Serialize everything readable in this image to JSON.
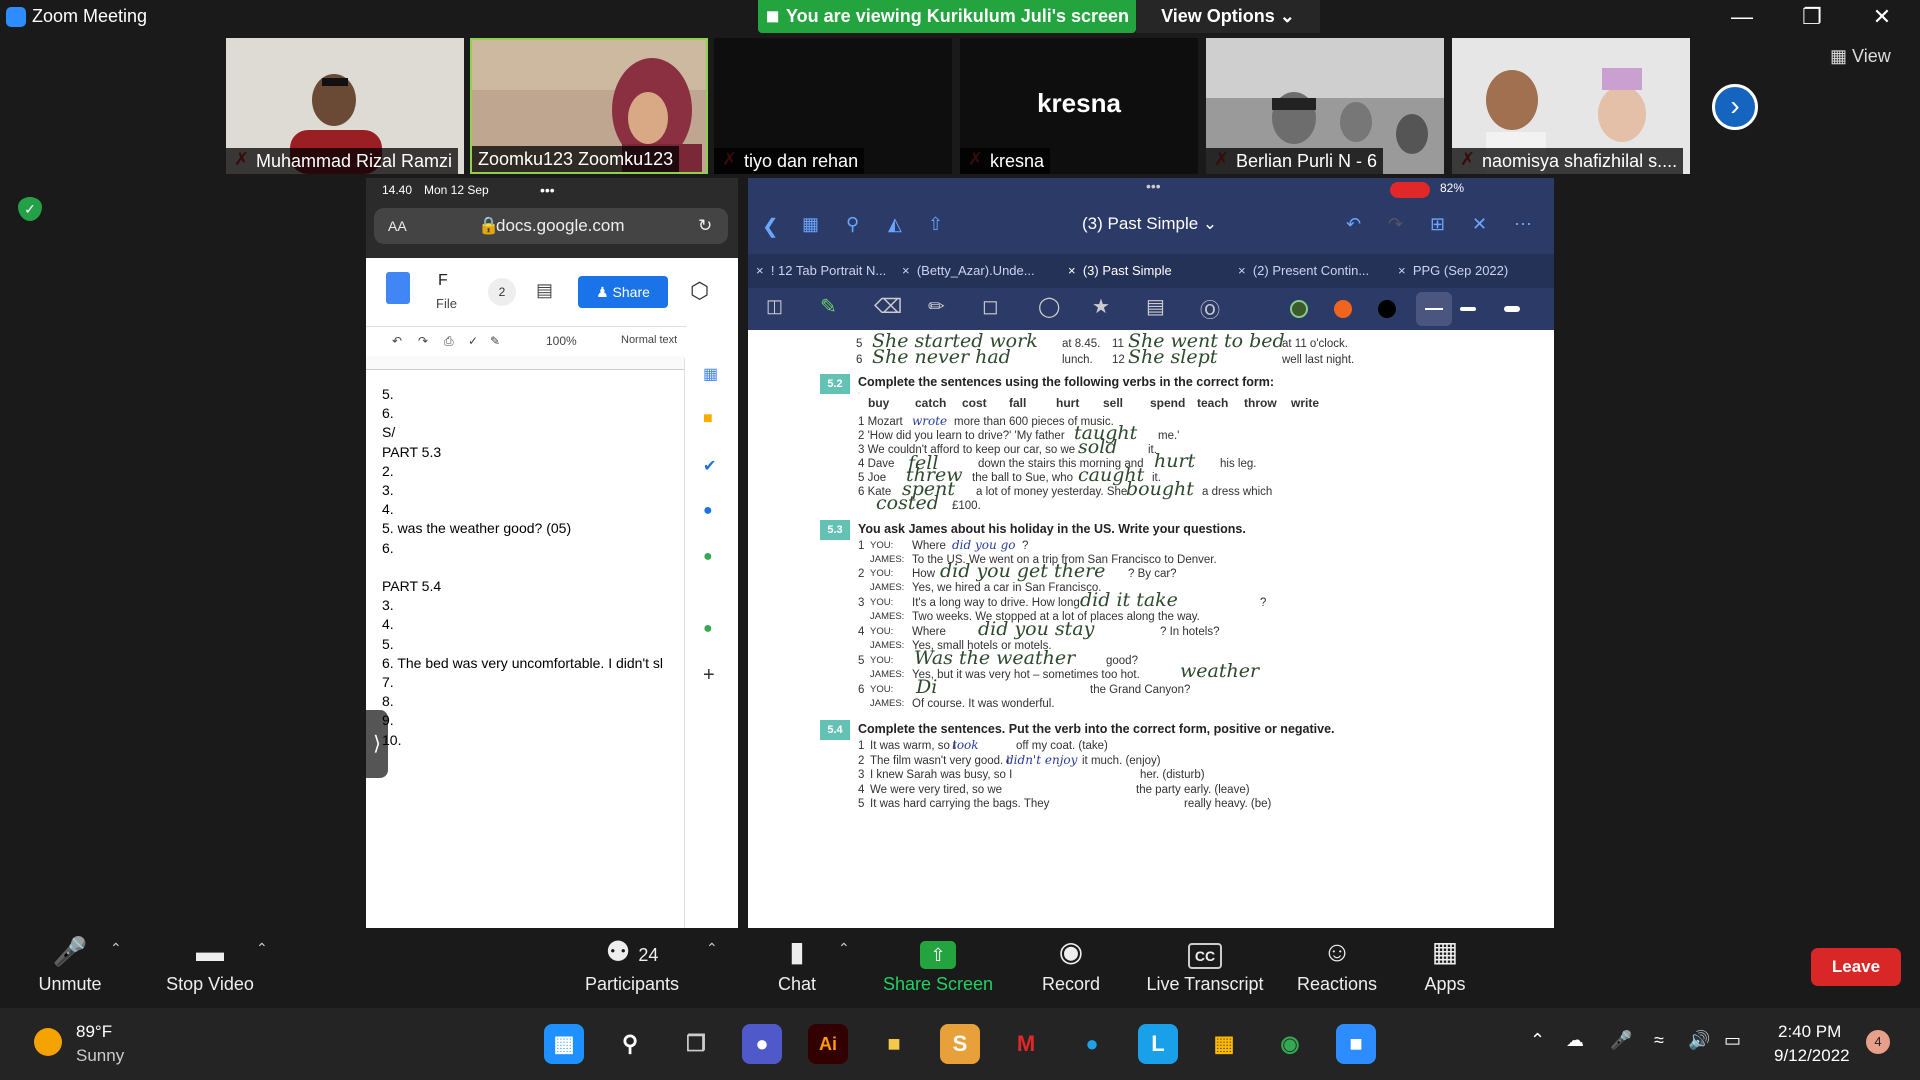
{
  "window": {
    "title": "Zoom Meeting",
    "viewing_banner": "You are viewing Kurikulum Juli's screen",
    "view_options": "View Options"
  },
  "gallery": {
    "participants": [
      {
        "name": "Muhammad Rizal Ramzi",
        "muted": true
      },
      {
        "name": "Zoomku123 Zoomku123",
        "muted": false
      },
      {
        "name": "tiyo dan rehan",
        "muted": true
      },
      {
        "name": "kresna",
        "muted": true,
        "display": "kresna"
      },
      {
        "name": "Berlian Purli N - 6",
        "muted": true
      },
      {
        "name": "naomisya shafizhilal s....",
        "muted": true
      }
    ],
    "view_label": "View"
  },
  "left_phone": {
    "time": "14.40",
    "date": "Mon 12 Sep",
    "url_aa": "AA",
    "url": "docs.google.com",
    "doc_title_initial": "F",
    "doc_menu": "File",
    "comment_count": "2",
    "share_label": "Share",
    "zoom_level": "100%",
    "style_label": "Normal text",
    "lines": [
      "5.",
      "6.",
      "S/",
      "PART 5.3",
      "2.",
      "3.",
      "4.",
      "5. was the weather good? (05)",
      "6.",
      "",
      "PART 5.4",
      "3.",
      "4.",
      "5.",
      "6. The bed was very uncomfortable. I didn't sl",
      "7.",
      "8.",
      "9.",
      "10."
    ]
  },
  "ipad": {
    "battery": "82%",
    "doc_title": "(3) Past Simple",
    "tabs": [
      "! 12 Tab Portrait N...",
      "(Betty_Azar).Unde...",
      "(3) Past Simple",
      "(2) Present Contin...",
      "PPG (Sep 2022)"
    ],
    "page": {
      "top_rows": [
        {
          "num": "5",
          "hw": "She started work",
          "tail": "at 8.45."
        },
        {
          "num": "6",
          "hw": "She never had",
          "tail": "lunch."
        },
        {
          "num": "11",
          "hw": "She went to bed",
          "tail": "at 11 o'clock."
        },
        {
          "num": "12",
          "hw": "She slept",
          "tail": "well last night."
        }
      ],
      "ex52": {
        "num": "5.2",
        "title": "Complete the sentences using the following verbs in the correct form:",
        "verbs": [
          "buy",
          "catch",
          "cost",
          "fall",
          "hurt",
          "sell",
          "spend",
          "teach",
          "throw",
          "write"
        ],
        "lines": [
          "1  Mozart",
          "more than 600 pieces of music.",
          "2  'How did you learn to drive?'   'My father",
          "me.'",
          "3  We couldn't afford to keep our car, so we",
          "it.",
          "4  Dave",
          "down the stairs this morning and",
          "his leg.",
          "5  Joe",
          "the ball to Sue, who",
          "it.",
          "6  Kate",
          "a lot of money yesterday.  She",
          "a dress which",
          "£100."
        ],
        "answers": [
          "wrote",
          "taught",
          "sold",
          "fell",
          "hurt",
          "threw",
          "caught",
          "spent",
          "bought",
          "costed"
        ]
      },
      "ex53": {
        "num": "5.3",
        "title": "You ask James about his holiday in the US.  Write your questions.",
        "you": "YOU:",
        "james": "JAMES:",
        "q1": "Where",
        "q1a": "did you go",
        "q1end": "?",
        "a1": "To the US. We went on a trip from San Francisco to Denver.",
        "q2": "How",
        "q2a": "did you get there",
        "q2end": "? By car?",
        "a2": "Yes, we hired a car in San Francisco.",
        "q3": "It's a long way to drive.  How long",
        "q3a": "did it take",
        "q3end": "?",
        "a3": "Two weeks. We stopped at a lot of places along the way.",
        "q4": "Where",
        "q4a": "did you stay",
        "q4end": "? In hotels?",
        "a4": "Yes, small hotels or motels.",
        "q5a": "Was the weather",
        "q5end": "good?",
        "a5": "Yes, but it was very hot – sometimes too hot.",
        "a5note": "weather",
        "q6a": "Di",
        "q6end": "the Grand Canyon?",
        "a6": "Of course.  It was wonderful.",
        "nums": [
          "1",
          "2",
          "3",
          "4",
          "5",
          "6"
        ]
      },
      "ex54": {
        "num": "5.4",
        "title": "Complete the sentences. Put the verb into the correct form, positive or negative.",
        "lines": [
          {
            "n": "1",
            "pre": "It was warm, so I",
            "ans": "took",
            "post": "off my coat. (take)"
          },
          {
            "n": "2",
            "pre": "The film wasn't very good.  I",
            "ans": "didn't enjoy",
            "post": "it much.  (enjoy)"
          },
          {
            "n": "3",
            "pre": "I knew Sarah was busy, so I",
            "ans": "",
            "post": "her.  (disturb)"
          },
          {
            "n": "4",
            "pre": "We were very tired, so we",
            "ans": "",
            "post": "the party early.  (leave)"
          },
          {
            "n": "5",
            "pre": "It was hard carrying the bags.  They",
            "ans": "",
            "post": "really heavy.  (be)"
          }
        ]
      }
    }
  },
  "controls": {
    "unmute": "Unmute",
    "stop_video": "Stop Video",
    "participants": "Participants",
    "participant_count": "24",
    "chat": "Chat",
    "share_screen": "Share Screen",
    "record": "Record",
    "live_transcript": "Live Transcript",
    "reactions": "Reactions",
    "apps": "Apps",
    "leave": "Leave"
  },
  "taskbar": {
    "weather_temp": "89°F",
    "weather_desc": "Sunny",
    "time": "2:40 PM",
    "date": "9/12/2022",
    "notif_count": "4"
  },
  "colors": {
    "zoom_blue": "#2d8cff",
    "share_green": "#23a43f",
    "leave_red": "#d92626"
  }
}
